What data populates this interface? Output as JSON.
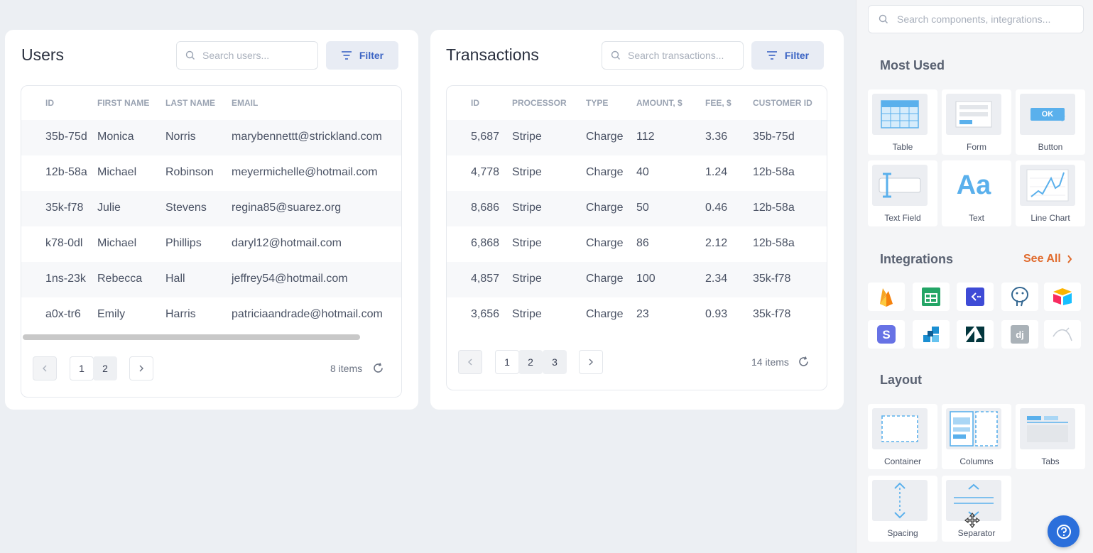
{
  "users": {
    "title": "Users",
    "search_placeholder": "Search users...",
    "filter_label": "Filter",
    "columns": [
      "ID",
      "FIRST NAME",
      "LAST NAME",
      "EMAIL"
    ],
    "rows": [
      [
        "35b-75d",
        "Monica",
        "Norris",
        "marybennettt@strickland.com"
      ],
      [
        "12b-58a",
        "Michael",
        "Robinson",
        "meyermichelle@hotmail.com"
      ],
      [
        "35k-f78",
        "Julie",
        "Stevens",
        "regina85@suarez.org"
      ],
      [
        "k78-0dl",
        "Michael",
        "Phillips",
        "daryl12@hotmail.com"
      ],
      [
        "1ns-23k",
        "Rebecca",
        "Hall",
        "jeffrey54@hotmail.com"
      ],
      [
        "a0x-tr6",
        "Emily",
        "Harris",
        "patriciaandrade@hotmail.com"
      ]
    ],
    "pages": [
      "1",
      "2"
    ],
    "items": "8 items"
  },
  "transactions": {
    "title": "Transactions",
    "search_placeholder": "Search transactions...",
    "filter_label": "Filter",
    "columns": [
      "ID",
      "PROCESSOR",
      "TYPE",
      "AMOUNT, $",
      "FEE, $",
      "CUSTOMER ID"
    ],
    "rows": [
      [
        "5,687",
        "Stripe",
        "Charge",
        "112",
        "3.36",
        "35b-75d"
      ],
      [
        "4,778",
        "Stripe",
        "Charge",
        "40",
        "1.24",
        "12b-58a"
      ],
      [
        "8,686",
        "Stripe",
        "Charge",
        "50",
        "0.46",
        "12b-58a"
      ],
      [
        "6,868",
        "Stripe",
        "Charge",
        "86",
        "2.12",
        "12b-58a"
      ],
      [
        "4,857",
        "Stripe",
        "Charge",
        "100",
        "2.34",
        "35k-f78"
      ],
      [
        "3,656",
        "Stripe",
        "Charge",
        "23",
        "0.93",
        "35k-f78"
      ]
    ],
    "pages": [
      "1",
      "2",
      "3"
    ],
    "items": "14 items"
  },
  "panel": {
    "search_placeholder": "Search components, integrations...",
    "most_used_title": "Most Used",
    "most_used": [
      "Table",
      "Form",
      "Button",
      "Text Field",
      "Text",
      "Line Chart"
    ],
    "button_thumb_text": "OK",
    "text_thumb_text": "Aa",
    "integrations_title": "Integrations",
    "see_all": "See All",
    "integrations": [
      "firebase-icon",
      "google-sheets-icon",
      "retool-api-icon",
      "postgresql-icon",
      "airtable-icon",
      "stripe-icon",
      "slack-icon",
      "zendesk-icon",
      "django-icon",
      "mysql-icon"
    ],
    "layout_title": "Layout",
    "layout": [
      "Container",
      "Columns",
      "Tabs",
      "Spacing",
      "Separator"
    ]
  },
  "colors": {
    "accent": "#3b64c4",
    "see_all": "#e06a2c",
    "help": "#2b6fdb"
  }
}
